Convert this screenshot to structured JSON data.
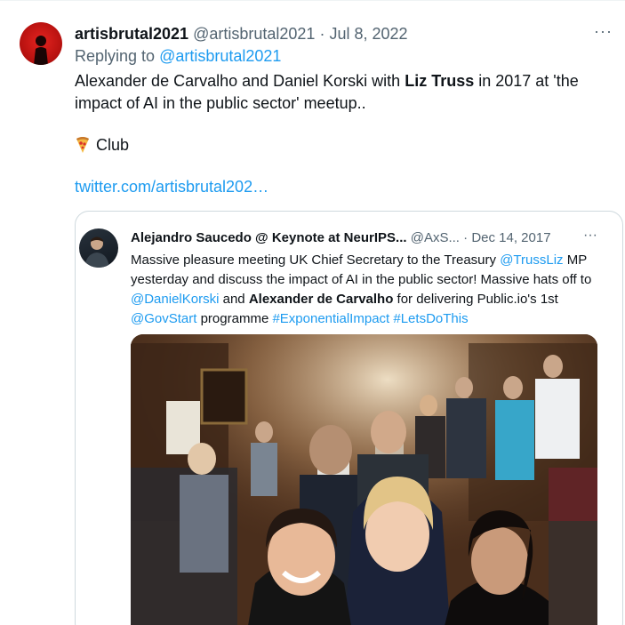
{
  "tweet": {
    "author_name": "artisbrutal2021",
    "author_handle": "@artisbrutal2021",
    "separator": "·",
    "date": "Jul 8, 2022",
    "more": "···",
    "replying_prefix": "Replying to ",
    "replying_handle": "@artisbrutal2021",
    "text_part1": "Alexander de Carvalho and Daniel Korski with ",
    "text_bold": "Liz Truss",
    "text_part2": " in 2017 at 'the impact of AI in the public sector' meetup..",
    "club_text": "Club",
    "link": "twitter.com/artisbrutal202…"
  },
  "quote": {
    "author_name": "Alejandro Saucedo @ Keynote at NeurIPS...",
    "author_handle": "@AxS...",
    "separator": "·",
    "date": "Dec 14, 2017",
    "more": "···",
    "text_1": "Massive pleasure meeting UK Chief Secretary to the Treasury ",
    "mention_truss": "@TrussLiz",
    "text_2": " MP yesterday and discuss the impact of AI in the public sector! Massive hats off to ",
    "mention_korski": "@DanielKorski",
    "text_3": " and ",
    "bold_name": "Alexander de Carvalho",
    "text_4": " for delivering Public.io's 1st ",
    "mention_govstart": "@GovStart",
    "text_5": " programme ",
    "hashtag_1": "#ExponentialImpact",
    "text_6": " ",
    "hashtag_2": "#LetsDoThis"
  },
  "icons": {
    "avatar": "avatar-icon",
    "pizza": "pizza-icon",
    "more": "more-icon"
  },
  "colors": {
    "link": "#1d9bf0",
    "muted": "#536471",
    "text": "#0f1419",
    "border": "#cfd9de"
  }
}
